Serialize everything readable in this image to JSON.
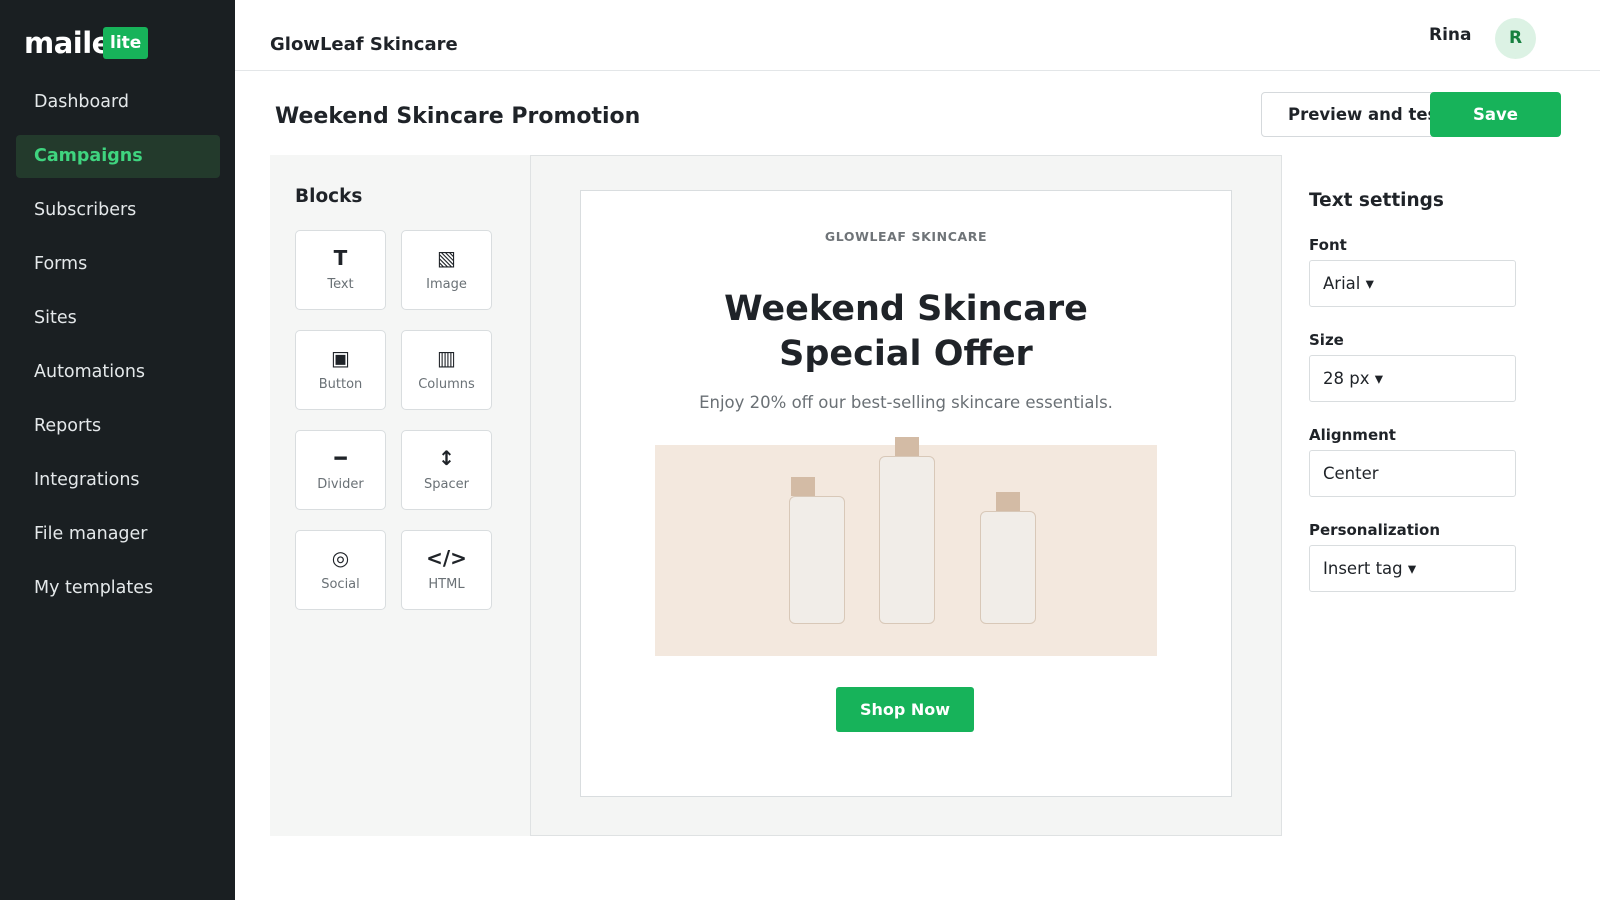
{
  "sidebar": {
    "logo_text": "mailerlite",
    "logo_badge": "lite",
    "items": [
      {
        "label": "Dashboard"
      },
      {
        "label": "Campaigns"
      },
      {
        "label": "Subscribers"
      },
      {
        "label": "Forms"
      },
      {
        "label": "Sites"
      },
      {
        "label": "Automations"
      },
      {
        "label": "Reports"
      },
      {
        "label": "Integrations"
      },
      {
        "label": "File manager"
      },
      {
        "label": "My templates"
      }
    ],
    "active_item": "Campaigns"
  },
  "header": {
    "brand": "GlowLeaf Skincare",
    "user_name": "Rina",
    "avatar_initial": "R"
  },
  "page": {
    "title": "Weekend Skincare Promotion",
    "preview_button": "Preview and test",
    "save_button": "Save"
  },
  "blocks": {
    "title": "Blocks",
    "items": [
      {
        "label": "Text",
        "icon": "text-icon",
        "glyph": "T"
      },
      {
        "label": "Image",
        "icon": "image-icon",
        "glyph": "▧"
      },
      {
        "label": "Button",
        "icon": "button-icon",
        "glyph": "▣"
      },
      {
        "label": "Columns",
        "icon": "columns-icon",
        "glyph": "▥"
      },
      {
        "label": "Divider",
        "icon": "divider-icon",
        "glyph": "━"
      },
      {
        "label": "Spacer",
        "icon": "spacer-icon",
        "glyph": "↕"
      },
      {
        "label": "Social",
        "icon": "social-icon",
        "glyph": "◎"
      },
      {
        "label": "HTML",
        "icon": "html-icon",
        "glyph": "</>"
      }
    ]
  },
  "email": {
    "brand": "GLOWLEAF SKINCARE",
    "headline_line1": "Weekend Skincare",
    "headline_line2": "Special Offer",
    "subtext": "Enjoy 20% off our best-selling skincare essentials.",
    "cta": "Shop Now"
  },
  "settings": {
    "title": "Text settings",
    "font_label": "Font",
    "font_value": "Arial ▾",
    "size_label": "Size",
    "size_value": "28 px ▾",
    "alignment_label": "Alignment",
    "alignment_value": "Center",
    "personalization_label": "Personalization",
    "personalization_value": "Insert tag ▾"
  },
  "colors": {
    "sidebar_bg": "#1a1f22",
    "accent": "#17b35a",
    "active_nav_text": "#3fd47f",
    "hero_bg": "#f3e8de"
  }
}
